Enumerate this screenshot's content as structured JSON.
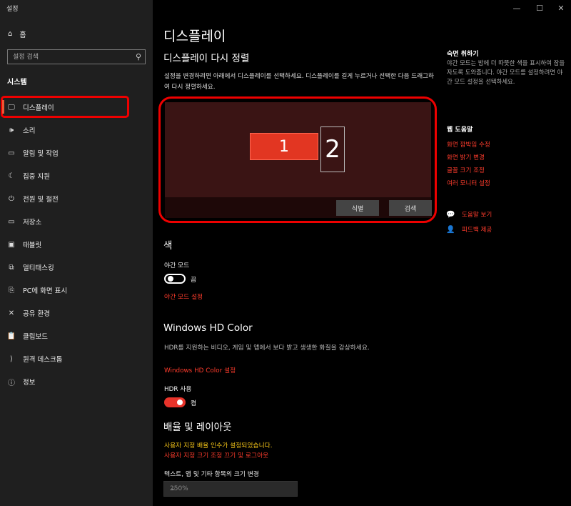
{
  "window": {
    "title": "설정",
    "minimize": "—",
    "maximize": "☐",
    "close": "✕"
  },
  "sidebar": {
    "home_label": "홈",
    "search_placeholder": "설정 검색",
    "section": "시스템",
    "items": [
      {
        "label": "디스플레이",
        "icon": "monitor-icon",
        "glyph": "🖵"
      },
      {
        "label": "소리",
        "icon": "speaker-icon",
        "glyph": "🕪"
      },
      {
        "label": "알림 및 작업",
        "icon": "notification-icon",
        "glyph": "▭"
      },
      {
        "label": "집중 지원",
        "icon": "moon-icon",
        "glyph": "☾"
      },
      {
        "label": "전원 및 절전",
        "icon": "power-icon",
        "glyph": "⏻"
      },
      {
        "label": "저장소",
        "icon": "storage-icon",
        "glyph": "▭"
      },
      {
        "label": "태블릿",
        "icon": "tablet-icon",
        "glyph": "▣"
      },
      {
        "label": "멀티태스킹",
        "icon": "multitask-icon",
        "glyph": "⧉"
      },
      {
        "label": "PC에 화면 표시",
        "icon": "project-icon",
        "glyph": "⎘"
      },
      {
        "label": "공유 환경",
        "icon": "shared-icon",
        "glyph": "✕"
      },
      {
        "label": "클립보드",
        "icon": "clipboard-icon",
        "glyph": "📋"
      },
      {
        "label": "원격 데스크톱",
        "icon": "remote-icon",
        "glyph": "⟩"
      },
      {
        "label": "정보",
        "icon": "info-icon",
        "glyph": "ⓘ"
      }
    ]
  },
  "main": {
    "title": "디스플레이",
    "rearrange_heading": "디스플레이 다시 정렬",
    "rearrange_desc": "설정을 변경하려면 아래에서 디스플레이를 선택하세요. 디스플레이를 길게 누르거나 선택한 다음 드래그하여 다시 정렬하세요.",
    "monitor1": "1",
    "monitor2": "2",
    "identify_button": "식별",
    "detect_button": "검색",
    "color_heading": "색",
    "night_mode_label": "야간 모드",
    "night_mode_state": "끔",
    "night_mode_settings_link": "야간 모드 설정",
    "hdr_heading": "Windows HD Color",
    "hdr_desc": "HDR를 지원하는 비디오, 게임 및 앱에서 보다 밝고 생생한 화질을 감상하세요.",
    "hdr_settings_link": "Windows HD Color 설정",
    "hdr_use_label": "HDR 사용",
    "hdr_use_state": "켬",
    "scale_heading": "배율 및 레이아웃",
    "custom_scale_warning": "사용자 지정 배율 인수가 설정되었습니다.",
    "custom_scale_link": "사용자 지정 크기 조정 끄기 및 로그아웃",
    "scale_label": "텍스트, 앱 및 기타 항목의 크기 변경",
    "scale_value": "250%"
  },
  "right": {
    "sleep_heading": "숙면 취하기",
    "sleep_desc": "야간 모드는 밤에 더 따뜻한 색을 표시하여 잠을 자도록 도와줍니다. 야간 모드를 설정하려면 야간 모드 설정을 선택하세요.",
    "web_help_heading": "웹 도움말",
    "links": [
      "화면 깜박임 수정",
      "화면 밝기 변경",
      "글꼴 크기 조정",
      "여러 모니터 설정"
    ],
    "get_help": "도움말 보기",
    "feedback": "피드백 제공"
  }
}
